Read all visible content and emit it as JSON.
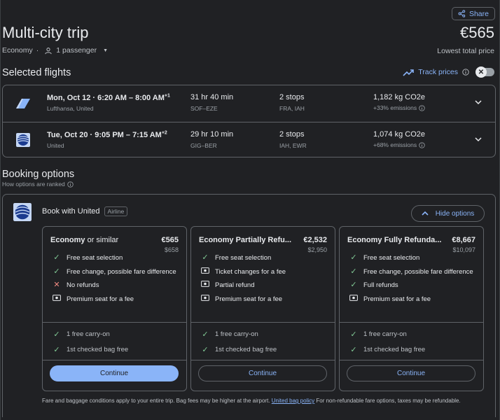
{
  "header": {
    "share_label": "Share",
    "title": "Multi-city trip",
    "price": "€565",
    "cabin": "Economy",
    "passengers": "1 passenger",
    "lowest_label": "Lowest total price"
  },
  "selected": {
    "title": "Selected flights",
    "track_label": "Track prices",
    "flights": [
      {
        "date": "Mon, Oct 12",
        "times": "6:20 AM – 8:00 AM",
        "plus": "+1",
        "airline": "Lufthansa, United",
        "duration": "31 hr 40 min",
        "route": "SOF–EZE",
        "stops": "2 stops",
        "stop_airports": "FRA, IAH",
        "co2": "1,182 kg CO2e",
        "emissions": "+33% emissions"
      },
      {
        "date": "Tue, Oct 20",
        "times": "9:05 PM – 7:15 AM",
        "plus": "+2",
        "airline": "United",
        "duration": "29 hr 10 min",
        "route": "GIG–BER",
        "stops": "2 stops",
        "stop_airports": "IAH, EWR",
        "co2": "1,074 kg CO2e",
        "emissions": "+68% emissions"
      }
    ]
  },
  "booking": {
    "title": "Booking options",
    "how_ranked": "How options are ranked",
    "book_with": "Book with United",
    "tag": "Airline",
    "hide_label": "Hide options",
    "cards": [
      {
        "name": "Economy",
        "name_suffix": " or similar",
        "price": "€565",
        "old_price": "$658",
        "features": [
          {
            "icon": "check",
            "text": "Free seat selection"
          },
          {
            "icon": "check",
            "text": "Free change, possible fare difference"
          },
          {
            "icon": "cross",
            "text": "No refunds"
          },
          {
            "icon": "money",
            "text": "Premium seat for a fee"
          }
        ],
        "bags": [
          "1 free carry-on",
          "1st checked bag free"
        ],
        "continue": "Continue"
      },
      {
        "name": "Economy Partially Refu...",
        "name_suffix": "",
        "price": "€2,532",
        "old_price": "$2,950",
        "features": [
          {
            "icon": "check",
            "text": "Free seat selection"
          },
          {
            "icon": "money",
            "text": "Ticket changes for a fee"
          },
          {
            "icon": "money",
            "text": "Partial refund"
          },
          {
            "icon": "money",
            "text": "Premium seat for a fee"
          }
        ],
        "bags": [
          "1 free carry-on",
          "1st checked bag free"
        ],
        "continue": "Continue"
      },
      {
        "name": "Economy Fully Refunda...",
        "name_suffix": "",
        "price": "€8,667",
        "old_price": "$10,097",
        "features": [
          {
            "icon": "check",
            "text": "Free seat selection"
          },
          {
            "icon": "check",
            "text": "Free change, possible fare difference"
          },
          {
            "icon": "check",
            "text": "Full refunds"
          },
          {
            "icon": "money",
            "text": "Premium seat for a fee"
          }
        ],
        "bags": [
          "1 free carry-on",
          "1st checked bag free"
        ],
        "continue": "Continue"
      }
    ],
    "footer_pre": "Fare and baggage conditions apply to your entire trip. Bag fees may be higher at the airport. ",
    "footer_link": "United bag policy",
    "footer_post": " For non-refundable fare options, taxes may be refundable."
  },
  "colors": {
    "accent": "#8ab4f8",
    "check": "#81c995",
    "cross": "#f28b82",
    "bg": "#202124"
  }
}
